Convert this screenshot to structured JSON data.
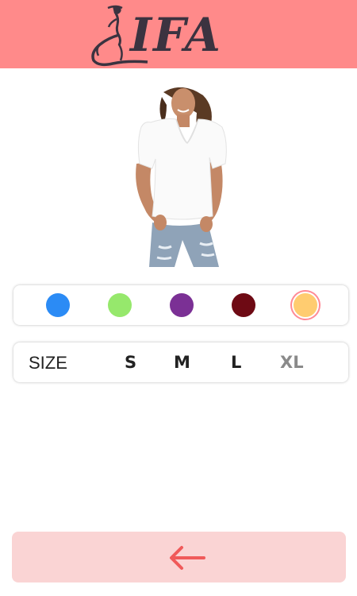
{
  "header": {
    "logo_text": "IFA",
    "background_color": "#ff8a8a"
  },
  "product": {
    "image": "woman-in-white-v-neck-tshirt"
  },
  "colors": {
    "swatches": [
      {
        "name": "blue",
        "hex": "#2b8bf5"
      },
      {
        "name": "green",
        "hex": "#96e86c"
      },
      {
        "name": "purple",
        "hex": "#7b3095"
      },
      {
        "name": "maroon",
        "hex": "#6e0a14"
      },
      {
        "name": "yellow",
        "hex": "#ffcc70",
        "selected": true
      }
    ]
  },
  "size": {
    "label": "SIZE",
    "options": [
      "S",
      "M",
      "L",
      "XL"
    ],
    "muted_option": "XL"
  },
  "footer": {
    "back_icon": "arrow-left-icon",
    "background_color": "#fad4d4",
    "arrow_color": "#f05a5a"
  }
}
